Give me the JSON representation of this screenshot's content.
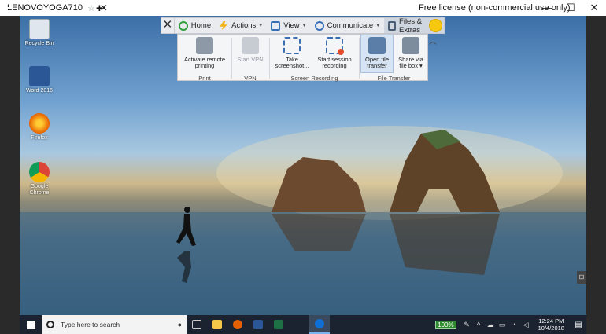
{
  "window": {
    "tab_title": "LENOVOYOGA710",
    "tab_star": "☆",
    "tab_close": "✕",
    "new_tab": "+",
    "license_text": "Free license (non-commercial use only)",
    "minimize": "—",
    "maximize": "☐",
    "close": "✕"
  },
  "toolbar": {
    "close": "✕",
    "items": [
      {
        "label": "Home",
        "color": "#2e9f3a"
      },
      {
        "label": "Actions",
        "color": "#f2b417"
      },
      {
        "label": "View",
        "color": "#3a6fb5"
      },
      {
        "label": "Communicate",
        "color": "#3a6fb5"
      },
      {
        "label": "Files & Extras",
        "color": "#4a5e79"
      }
    ],
    "collapse": "︿"
  },
  "ribbon": {
    "buttons": [
      {
        "label": "Activate remote printing",
        "line1": "Activate remote",
        "line2": "printing",
        "enabled": true
      },
      {
        "label": "Start VPN",
        "line1": "Start VPN",
        "line2": "",
        "enabled": false
      },
      {
        "label": "Take screenshot...",
        "line1": "Take",
        "line2": "screenshot...",
        "enabled": true
      },
      {
        "label": "Start session recording",
        "line1": "Start session",
        "line2": "recording",
        "enabled": true
      },
      {
        "label": "Open file transfer",
        "line1": "Open file",
        "line2": "transfer",
        "enabled": true,
        "highlighted": true
      },
      {
        "label": "Share via file box",
        "line1": "Share via",
        "line2": "file box ▾",
        "enabled": true
      }
    ],
    "groups": [
      "Print",
      "VPN",
      "Screen Recording",
      "File Transfer"
    ]
  },
  "desktop": {
    "icons": [
      {
        "label": "Recycle Bin",
        "icon": "recycle-bin-icon"
      },
      {
        "label": "Word 2016",
        "icon": "word-icon"
      },
      {
        "label": "Firefox",
        "icon": "firefox-icon"
      },
      {
        "label": "Google Chrome",
        "icon": "chrome-icon"
      }
    ]
  },
  "taskbar": {
    "search_placeholder": "Type here to search",
    "zoom": "100%",
    "time": "12:24 PM",
    "date": "10/4/2018"
  }
}
